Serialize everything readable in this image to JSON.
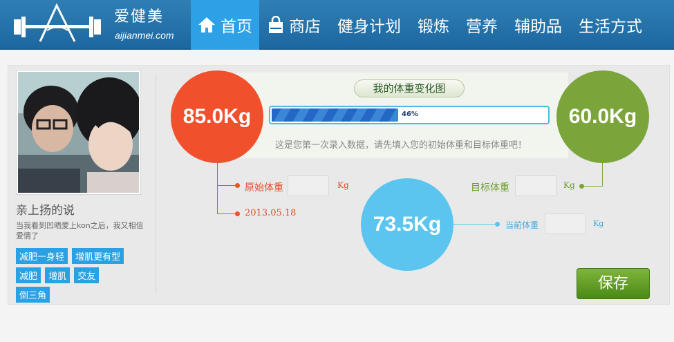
{
  "header": {
    "logo_cn": "爱健美",
    "logo_en": "aijianmei.com",
    "nav": [
      {
        "label": "首页",
        "icon": "home-icon"
      },
      {
        "label": "商店",
        "icon": "shopping-bag-icon"
      },
      {
        "label": "健身计划"
      },
      {
        "label": "锻炼"
      },
      {
        "label": "营养"
      },
      {
        "label": "辅助品"
      },
      {
        "label": "生活方式"
      }
    ]
  },
  "profile": {
    "username": "亲上扬的说",
    "bio": "当我看到凹晒爱上kon之后，我又相信爱情了",
    "tags": [
      "减肥一身轻",
      "增肌更有型",
      "减肥",
      "增肌",
      "交友",
      "倒三角"
    ]
  },
  "weight": {
    "chart_title": "我的体重变化图",
    "progress_percent": 46,
    "progress_label": "46%",
    "hint": "这是您第一次录入数据，请先填入您的初始体重和目标体重吧！",
    "original_value": "85.0Kg",
    "target_value": "60.0Kg",
    "current_value": "73.5Kg",
    "original_label": "原始体重",
    "target_label": "目标体重",
    "current_label": "当前体重",
    "unit": "Kg",
    "date": "2013.05.18",
    "save_label": "保存"
  },
  "colors": {
    "original": "#f1502c",
    "target": "#7ba53a",
    "current": "#5bc5ef",
    "nav_active": "#2ea0e6"
  }
}
